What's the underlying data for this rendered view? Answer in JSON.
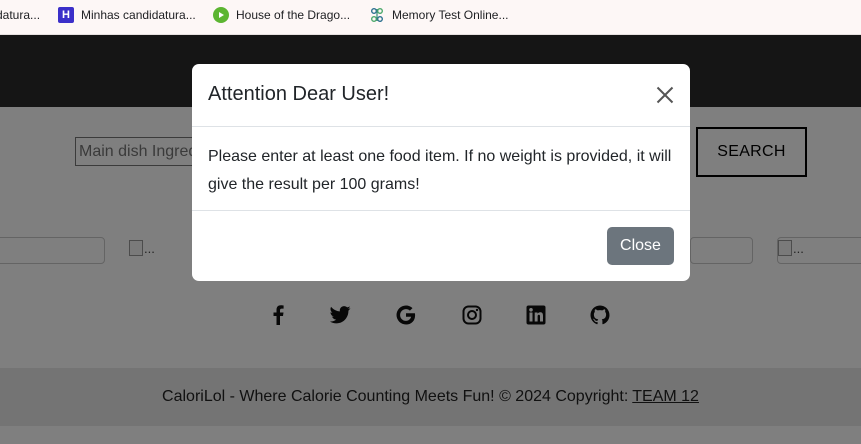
{
  "bookmarks": [
    {
      "label": "datura...",
      "icon": "doc-icon"
    },
    {
      "label": "Minhas candidatura...",
      "icon": "h-logo-icon"
    },
    {
      "label": "House of the Drago...",
      "icon": "play-icon"
    },
    {
      "label": "Memory Test Online...",
      "icon": "puzzle-icon"
    }
  ],
  "search": {
    "placeholder": "Main dish Ingredients",
    "button_label": "SEARCH"
  },
  "images": {
    "alt": "..."
  },
  "social_icons": [
    "facebook-icon",
    "twitter-icon",
    "google-icon",
    "instagram-icon",
    "linkedin-icon",
    "github-icon"
  ],
  "footer": {
    "text": "CaloriLol - Where Calorie Counting Meets Fun! © 2024 Copyright:",
    "link": "TEAM 12"
  },
  "modal": {
    "title": "Attention Dear User!",
    "body": "Please enter at least one food item. If no weight is provided, it will give the result per 100 grams!",
    "close_label": "Close"
  },
  "colors": {
    "navbar": "#2b2b2b",
    "close_button": "#6c757d",
    "backdrop": "rgba(0,0,0,0.5)"
  }
}
